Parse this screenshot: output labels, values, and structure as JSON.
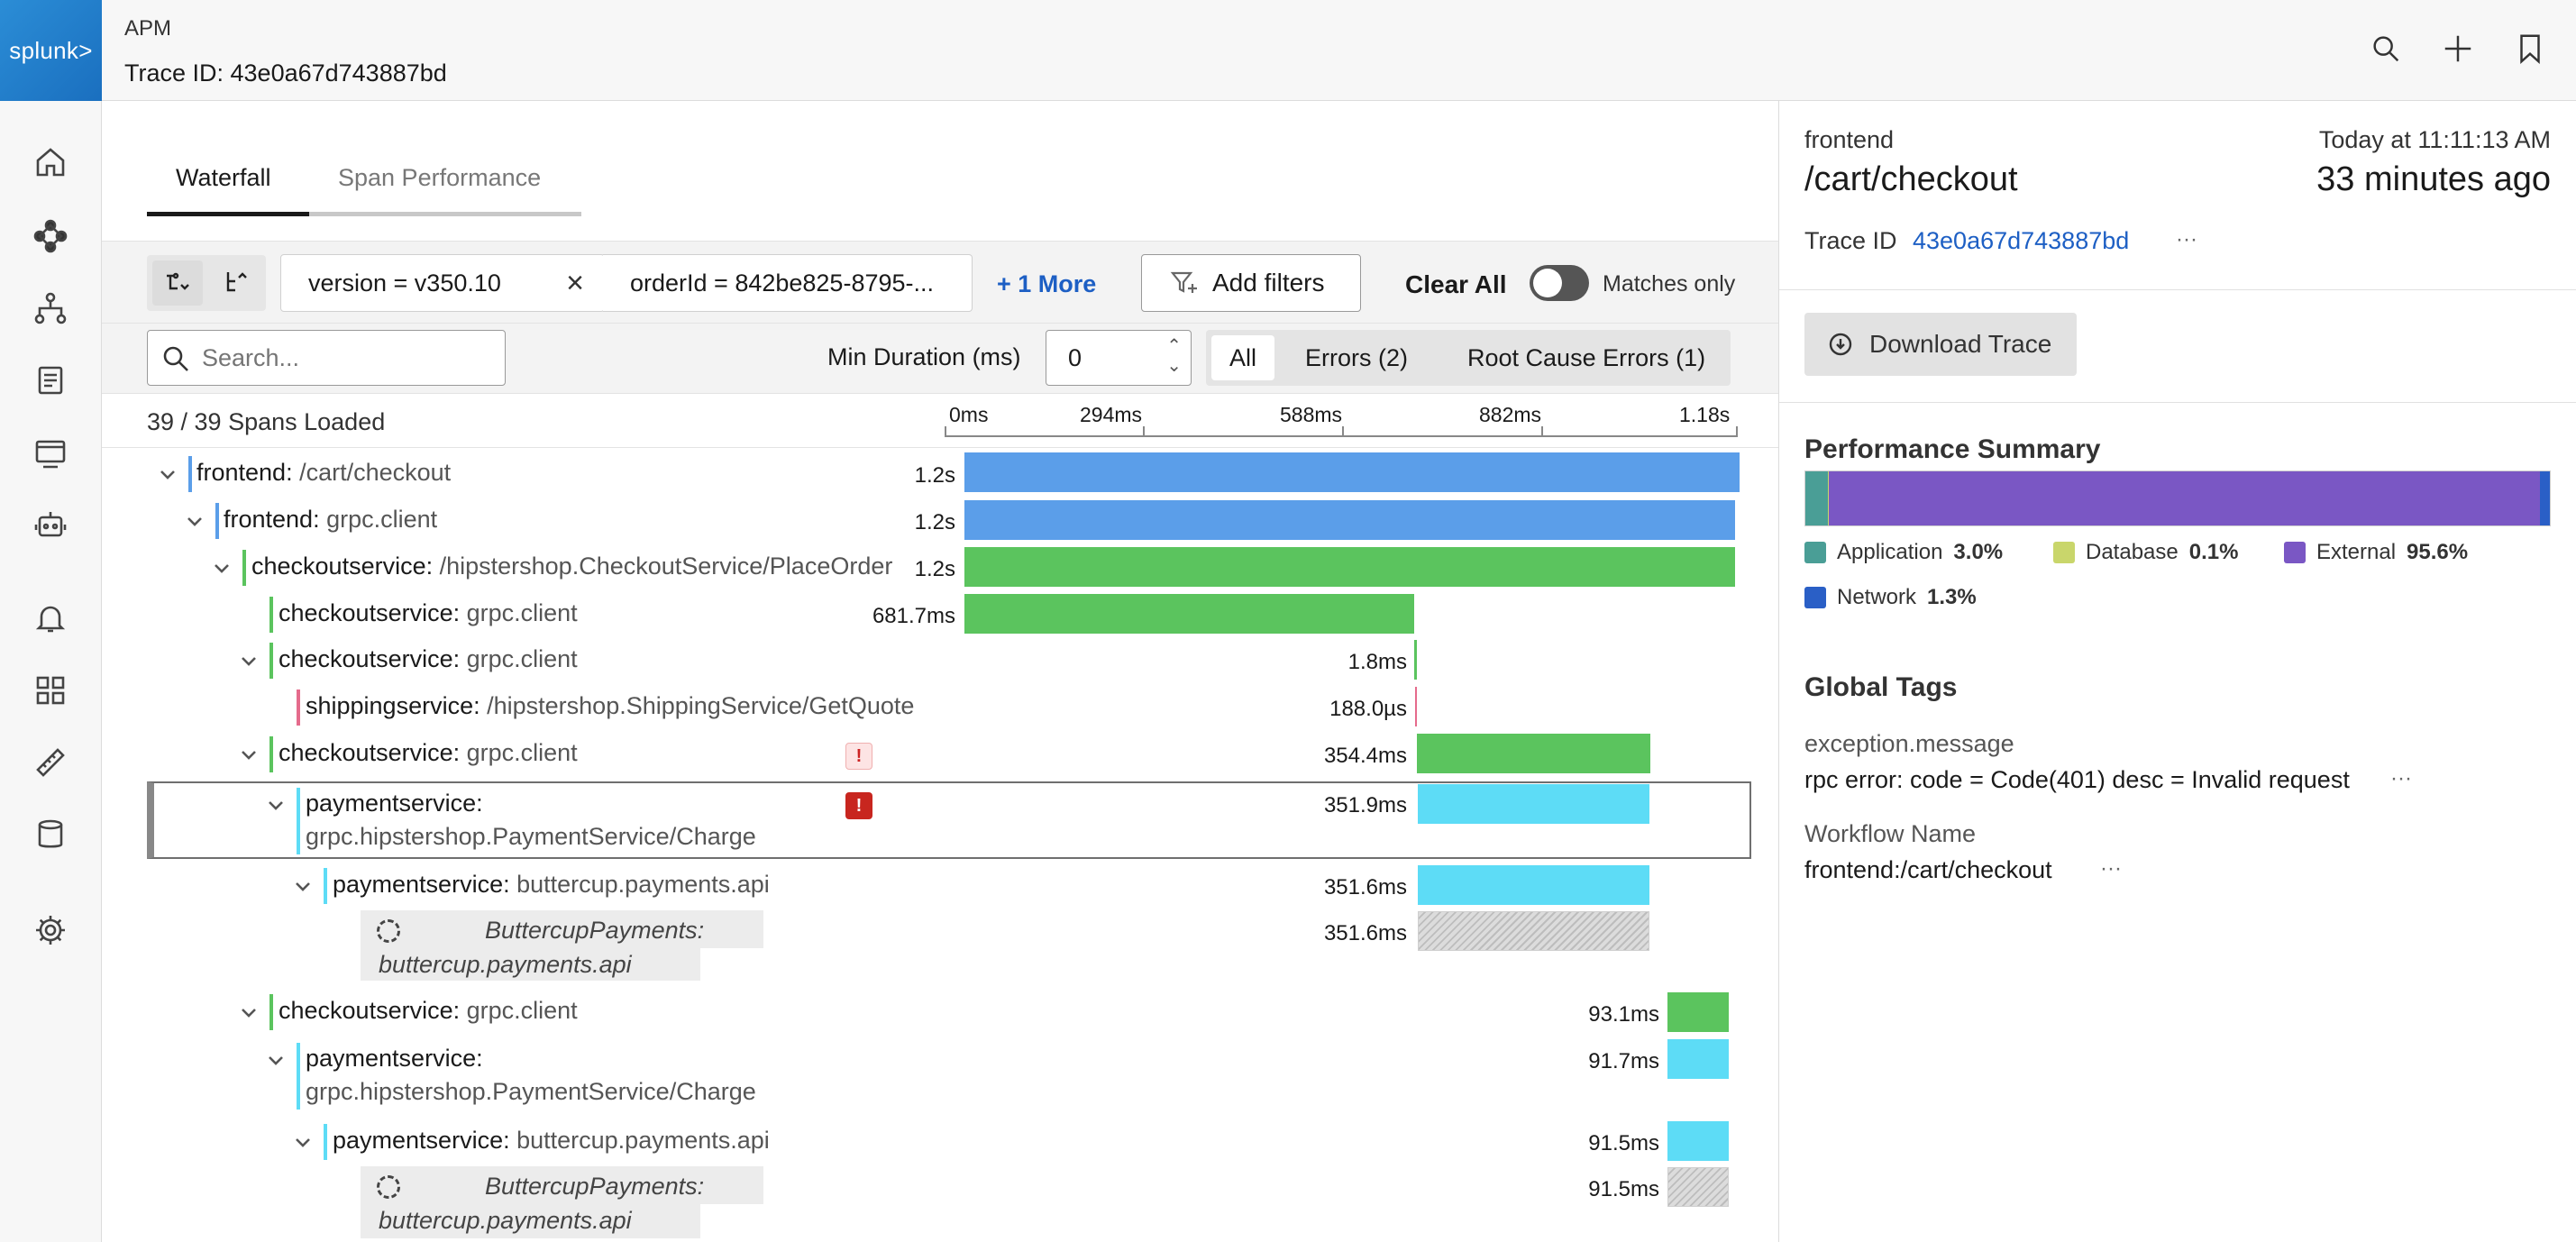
{
  "nav": {
    "logo": "splunk>"
  },
  "header": {
    "breadcrumb": "APM",
    "title": "Trace ID: 43e0a67d743887bd"
  },
  "tabs": [
    "Waterfall",
    "Span Performance"
  ],
  "filters": {
    "chips": [
      "version = v350.10",
      "orderId = 842be825-8795-..."
    ],
    "more": "+ 1 More",
    "add_filters": "Add filters",
    "clear_all": "Clear All",
    "matches_only": "Matches only"
  },
  "search": {
    "placeholder": "Search...",
    "min_duration_label": "Min Duration (ms)",
    "min_duration_value": "0"
  },
  "segments": [
    "All",
    "Errors (2)",
    "Root Cause Errors (1)"
  ],
  "spans_loaded": "39 / 39 Spans Loaded",
  "axis_ticks": [
    "0ms",
    "294ms",
    "588ms",
    "882ms",
    "1.18s"
  ],
  "rows": [
    {
      "svc": "frontend:",
      "op": "/cart/checkout",
      "dur": "1.2s",
      "color": "#5b9ee9"
    },
    {
      "svc": "frontend:",
      "op": "grpc.client",
      "dur": "1.2s",
      "color": "#5b9ee9"
    },
    {
      "svc": "checkoutservice:",
      "op": "/hipstershop.CheckoutService/PlaceOrder",
      "dur": "1.2s",
      "color": "#5bc45e"
    },
    {
      "svc": "checkoutservice:",
      "op": "grpc.client",
      "dur": "681.7ms",
      "color": "#5bc45e"
    },
    {
      "svc": "checkoutservice:",
      "op": "grpc.client",
      "dur": "1.8ms",
      "color": "#5bc45e"
    },
    {
      "svc": "shippingservice:",
      "op": "/hipstershop.ShippingService/GetQuote",
      "dur": "188.0µs",
      "color": "#e56b8c"
    },
    {
      "svc": "checkoutservice:",
      "op": "grpc.client",
      "dur": "354.4ms",
      "color": "#5bc45e"
    },
    {
      "svc": "paymentservice:",
      "op": "grpc.hipstershop.PaymentService/Charge",
      "dur": "351.9ms",
      "color": "#5ddcf6"
    },
    {
      "svc": "paymentservice:",
      "op": "buttercup.payments.api",
      "dur": "351.6ms",
      "color": "#5ddcf6"
    },
    {
      "svc": "ButtercupPayments:",
      "op": "buttercup.payments.api",
      "dur": "351.6ms",
      "color": "#cccccc"
    },
    {
      "svc": "checkoutservice:",
      "op": "grpc.client",
      "dur": "93.1ms",
      "color": "#5bc45e"
    },
    {
      "svc": "paymentservice:",
      "op": "grpc.hipstershop.PaymentService/Charge",
      "dur": "91.7ms",
      "color": "#5ddcf6"
    },
    {
      "svc": "paymentservice:",
      "op": "buttercup.payments.api",
      "dur": "91.5ms",
      "color": "#5ddcf6"
    },
    {
      "svc": "ButtercupPayments:",
      "op": "buttercup.payments.api",
      "dur": "91.5ms",
      "color": "#cccccc"
    }
  ],
  "error_marks": [
    "!",
    "!"
  ],
  "panel": {
    "service": "frontend",
    "operation": "/cart/checkout",
    "when": "Today at 11:11:13 AM",
    "ago": "33 minutes ago",
    "trace_id_label": "Trace ID",
    "trace_id": "43e0a67d743887bd",
    "ellipsis": "···",
    "download": "Download Trace",
    "perf_title": "Performance Summary",
    "perf": [
      {
        "label": "Application",
        "pct": "3.0%",
        "value": 3.0,
        "color": "#4a9e96"
      },
      {
        "label": "Database",
        "pct": "0.1%",
        "value": 0.1,
        "color": "#c9d66b"
      },
      {
        "label": "External",
        "pct": "95.6%",
        "value": 95.6,
        "color": "#7a57c4"
      },
      {
        "label": "Network",
        "pct": "1.3%",
        "value": 1.3,
        "color": "#2a5fc6"
      }
    ],
    "tags_title": "Global Tags",
    "tags": [
      {
        "key": "exception.message",
        "value": "rpc error: code = Code(401) desc = Invalid request"
      },
      {
        "key": "Workflow Name",
        "value": "frontend:/cart/checkout"
      }
    ]
  }
}
